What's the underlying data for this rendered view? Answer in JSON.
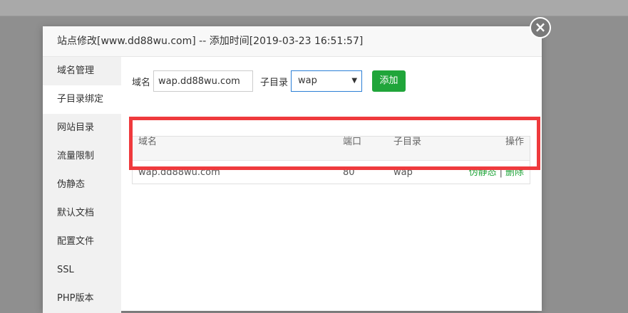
{
  "dialog": {
    "title": "站点修改[www.dd88wu.com] -- 添加时间[2019-03-23 16:51:57]",
    "close_label": "×"
  },
  "sidebar": {
    "items": [
      {
        "label": "域名管理"
      },
      {
        "label": "子目录绑定"
      },
      {
        "label": "网站目录"
      },
      {
        "label": "流量限制"
      },
      {
        "label": "伪静态"
      },
      {
        "label": "默认文档"
      },
      {
        "label": "配置文件"
      },
      {
        "label": "SSL"
      },
      {
        "label": "PHP版本"
      }
    ],
    "active_index": 1
  },
  "form": {
    "domain_label": "域名",
    "domain_value": "wap.dd88wu.com",
    "subdir_label": "子目录",
    "subdir_value": "wap",
    "subdir_arrow": "▼",
    "add_label": "添加"
  },
  "table": {
    "headers": {
      "domain": "域名",
      "port": "端口",
      "subdir": "子目录",
      "op": "操作"
    },
    "rows": [
      {
        "domain": "wap.dd88wu.com",
        "port": "80",
        "subdir": "wap",
        "op_rewrite": "伪静态",
        "op_sep": "|",
        "op_delete": "删除"
      }
    ]
  },
  "colors": {
    "accent_green": "#20a53a",
    "highlight_red": "#ef3a3d",
    "select_border": "#2c7fd6"
  }
}
